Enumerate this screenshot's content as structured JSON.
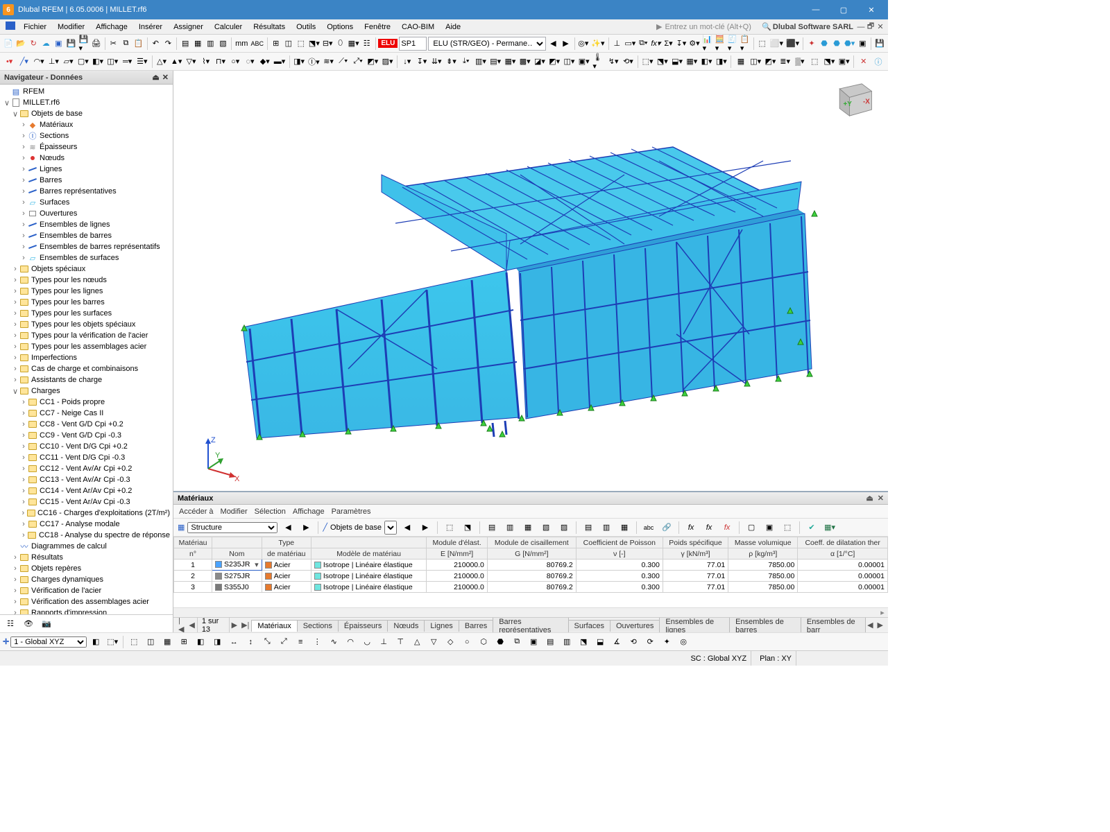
{
  "titlebar": {
    "app": "Dlubal RFEM",
    "version": "6.05.0006",
    "file": "MILLET.rf6"
  },
  "menubar": {
    "items": [
      "Fichier",
      "Modifier",
      "Affichage",
      "Insérer",
      "Assigner",
      "Calculer",
      "Résultats",
      "Outils",
      "Options",
      "Fenêtre",
      "CAO-BIM",
      "Aide"
    ],
    "search_placeholder": "Entrez un mot-clé (Alt+Q)",
    "brand": "Dlubal Software SARL"
  },
  "toolbar1": {
    "elu_tag": "ELU",
    "sp_field": "SP1",
    "combo": "ELU (STR/GEO) - Permane…"
  },
  "navigator": {
    "title": "Navigateur - Données",
    "root": "RFEM",
    "model": "MILLET.rf6",
    "objets_de_base": {
      "label": "Objets de base",
      "children": [
        "Matériaux",
        "Sections",
        "Épaisseurs",
        "Nœuds",
        "Lignes",
        "Barres",
        "Barres représentatives",
        "Surfaces",
        "Ouvertures",
        "Ensembles de lignes",
        "Ensembles de barres",
        "Ensembles de barres représentatifs",
        "Ensembles de surfaces"
      ]
    },
    "mid": [
      "Objets spéciaux",
      "Types pour les nœuds",
      "Types pour les lignes",
      "Types pour les barres",
      "Types pour les surfaces",
      "Types pour les objets spéciaux",
      "Types pour la vérification de l'acier",
      "Types pour les assemblages acier",
      "Imperfections",
      "Cas de charge et combinaisons",
      "Assistants de charge"
    ],
    "charges": {
      "label": "Charges",
      "items": [
        "CC1 - Poids propre",
        "CC7 - Neige Cas II",
        "CC8 - Vent G/D Cpi +0.2",
        "CC9 - Vent G/D Cpi -0.3",
        "CC10 - Vent D/G Cpi +0.2",
        "CC11 - Vent D/G Cpi -0.3",
        "CC12 - Vent Av/Ar Cpi +0.2",
        "CC13 - Vent Av/Ar Cpi -0.3",
        "CC14 - Vent Ar/Av Cpi +0.2",
        "CC15 - Vent Ar/Av Cpi -0.3",
        "CC16 - Charges d'exploitations (2T/m²)",
        "CC17 - Analyse modale",
        "CC18 - Analyse du spectre de réponse"
      ]
    },
    "tail": [
      "Diagrammes de calcul",
      "Résultats",
      "Objets repères",
      "Charges dynamiques",
      "Vérification de l'acier",
      "Vérification des assemblages acier",
      "Rapports d'impression"
    ]
  },
  "tablepanel": {
    "title": "Matériaux",
    "menu": [
      "Accéder à",
      "Modifier",
      "Sélection",
      "Affichage",
      "Paramètres"
    ],
    "structure_combo": "Structure",
    "objets_label": "Objets de base",
    "columns": [
      {
        "l1": "Matériau",
        "l2": "n°"
      },
      {
        "l1": "",
        "l2": "Nom"
      },
      {
        "l1": "Type",
        "l2": "de matériau"
      },
      {
        "l1": "",
        "l2": "Modèle de matériau"
      },
      {
        "l1": "Module d'élast.",
        "l2": "E [N/mm²]"
      },
      {
        "l1": "Module de cisaillement",
        "l2": "G [N/mm²]"
      },
      {
        "l1": "Coefficient de Poisson",
        "l2": "ν [-]"
      },
      {
        "l1": "Poids spécifique",
        "l2": "γ [kN/m³]"
      },
      {
        "l1": "Masse volumique",
        "l2": "ρ [kg/m³]"
      },
      {
        "l1": "Coeff. de dilatation ther",
        "l2": "α [1/°C]"
      }
    ],
    "rows": [
      {
        "n": "1",
        "nom": "S235JR",
        "sw": "#4aa3ff",
        "type": "Acier",
        "tsw": "#e67a2e",
        "model": "Isotrope | Linéaire élastique",
        "msw": "#6fe6e0",
        "E": "210000.0",
        "G": "80769.2",
        "nu": "0.300",
        "gamma": "77.01",
        "rho": "7850.00",
        "alpha": "0.00001"
      },
      {
        "n": "2",
        "nom": "S275JR",
        "sw": "#8a8a8a",
        "type": "Acier",
        "tsw": "#e67a2e",
        "model": "Isotrope | Linéaire élastique",
        "msw": "#6fe6e0",
        "E": "210000.0",
        "G": "80769.2",
        "nu": "0.300",
        "gamma": "77.01",
        "rho": "7850.00",
        "alpha": "0.00001"
      },
      {
        "n": "3",
        "nom": "S355J0",
        "sw": "#7a7a7a",
        "type": "Acier",
        "tsw": "#e67a2e",
        "model": "Isotrope | Linéaire élastique",
        "msw": "#6fe6e0",
        "E": "210000.0",
        "G": "80769.2",
        "nu": "0.300",
        "gamma": "77.01",
        "rho": "7850.00",
        "alpha": "0.00001"
      }
    ]
  },
  "tabsrow": {
    "pager": "1 sur 13",
    "tabs": [
      "Matériaux",
      "Sections",
      "Épaisseurs",
      "Nœuds",
      "Lignes",
      "Barres",
      "Barres représentatives",
      "Surfaces",
      "Ouvertures",
      "Ensembles de lignes",
      "Ensembles de barres",
      "Ensembles de barr"
    ]
  },
  "statusbar": {
    "cs_label": "1 - Global XYZ",
    "sc": "SC : Global XYZ",
    "plan": "Plan : XY"
  },
  "axes": {
    "x": "X",
    "y": "Y",
    "z": "Z"
  },
  "cube": {
    "ypos": "+Y",
    "xneg": "-X"
  }
}
